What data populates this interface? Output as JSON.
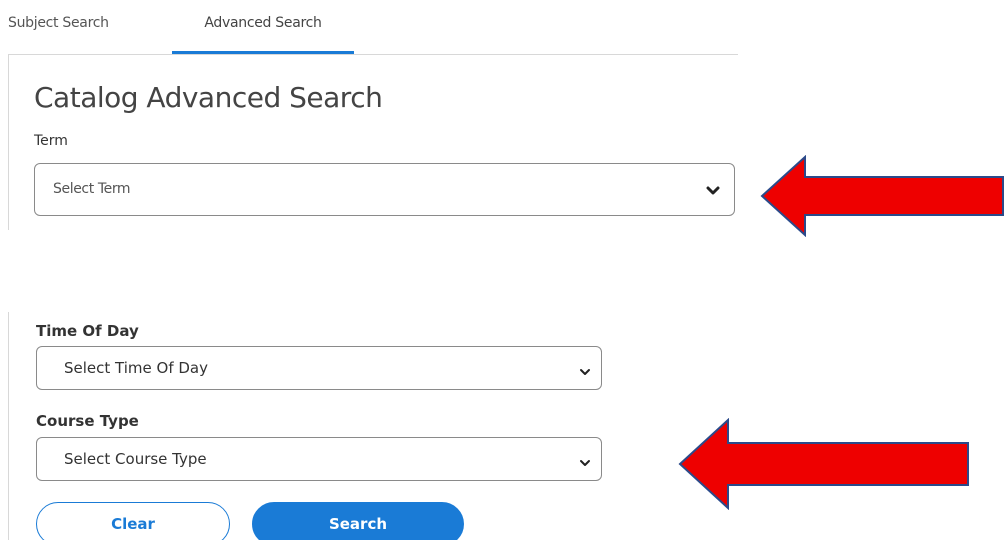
{
  "tabs": {
    "subject": "Subject Search",
    "advanced": "Advanced Search",
    "active": "Advanced Search"
  },
  "page": {
    "title": "Catalog Advanced Search"
  },
  "term": {
    "label": "Term",
    "value": "Select Term",
    "icon": "chevron-down-icon"
  },
  "time_of_day": {
    "label": "Time Of Day",
    "value": "Select Time Of Day",
    "icon": "chevron-down-icon"
  },
  "course_type": {
    "label": "Course Type",
    "value": "Select Course Type",
    "icon": "chevron-down-icon"
  },
  "buttons": {
    "clear": "Clear",
    "search": "Search"
  },
  "annotations": {
    "arrow_count": 2,
    "arrow_icon": "left-arrow-icon",
    "arrow_color": "#ee0000",
    "arrow_outline": "#2b4a8a"
  },
  "colors": {
    "accent": "#1a7bd6",
    "border": "#8a8a8a"
  }
}
